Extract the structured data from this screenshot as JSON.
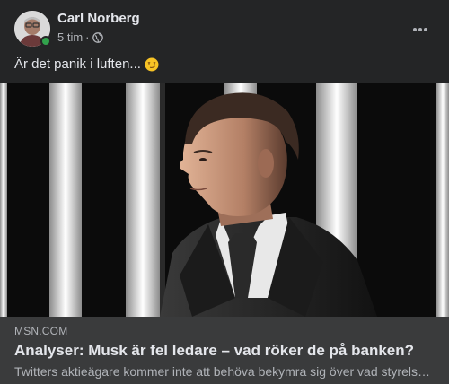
{
  "post": {
    "author": "Carl Norberg",
    "time": "5 tim",
    "separator": "·",
    "audience_icon": "globe-icon",
    "more_icon": "more-options-icon",
    "text": "Är det panik i luften...",
    "emoji_icon": "smirking-face-emoji",
    "online_status_color": "#31a24c"
  },
  "link_preview": {
    "domain": "MSN.COM",
    "title": "Analyser: Musk är fel ledare – vad röker de på banken?",
    "description": "Twitters aktieägare kommer inte att behöva bekymra sig över vad styrelsen på Twitter tycker om deras nya ägare"
  },
  "colors": {
    "background": "#242526",
    "preview_background": "#3a3b3c",
    "primary_text": "#e4e6eb",
    "secondary_text": "#b0b3b8"
  }
}
